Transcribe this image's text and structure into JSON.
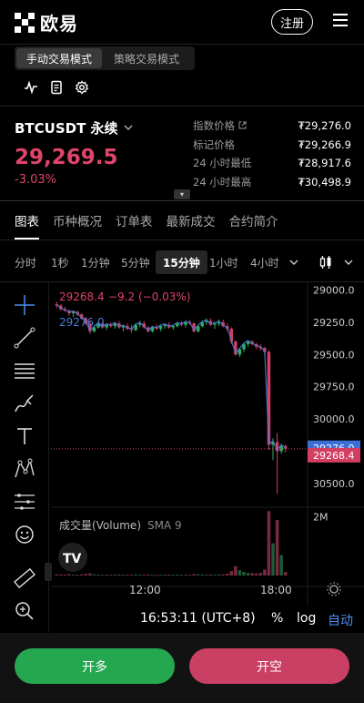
{
  "header": {
    "logo_text": "欧易",
    "register_label": "注册"
  },
  "modes": {
    "manual_label": "手动交易模式",
    "strategy_label": "策略交易模式"
  },
  "ticker": {
    "pair": "BTCUSDT 永续",
    "price": "29,269.5",
    "change": "-3.03%",
    "stats": [
      {
        "label": "指数价格",
        "value": "₮29,276.0"
      },
      {
        "label": "标记价格",
        "value": "₮29,266.9"
      },
      {
        "label": "24 小时最低",
        "value": "₮28,917.6"
      },
      {
        "label": "24 小时最高",
        "value": "₮30,498.9"
      }
    ]
  },
  "tabs": [
    "图表",
    "币种概况",
    "订单表",
    "最新成交",
    "合约简介"
  ],
  "intervals": [
    "分时",
    "1秒",
    "1分钟",
    "5分钟",
    "15分钟",
    "1小时",
    "4小时"
  ],
  "selected_interval": "15分钟",
  "chart": {
    "ohlc_label": "29268.4",
    "change_label": "−9.2 (−0.03%)",
    "index_label": "29276.0",
    "y_ticks": [
      "30500.0",
      "30250.0",
      "30000.0",
      "29750.0",
      "29500.0",
      "29250.0",
      "29000.0"
    ],
    "price_tag_index": "29276.0",
    "price_tag_last": "29268.4",
    "volume_label": "成交量(Volume)",
    "sma_label": "SMA 9",
    "volume_tick": "2M",
    "x_ticks": [
      "12:00",
      "18:00"
    ],
    "time_label": "16:53:11 (UTC+8)",
    "percent_label": "%",
    "log_label": "log",
    "auto_label": "自动",
    "colors": {
      "up": "#2bb064",
      "down": "#d23f62",
      "index_line": "#4a78d8"
    }
  },
  "chart_data": {
    "type": "candlestick",
    "x_ticks": [
      "12:00",
      "18:00"
    ],
    "ylim": [
      28900,
      30560
    ],
    "y_ticks": [
      29000,
      29250,
      29500,
      29750,
      30000,
      30250,
      30500
    ],
    "last_price": 29268.4,
    "index_price": 29276.0,
    "candles": [
      [
        30390,
        30410,
        30360,
        30380
      ],
      [
        30380,
        30390,
        30340,
        30350
      ],
      [
        30350,
        30370,
        30330,
        30340
      ],
      [
        30340,
        30350,
        30300,
        30320
      ],
      [
        30320,
        30340,
        30290,
        30330
      ],
      [
        30330,
        30340,
        30300,
        30310
      ],
      [
        30310,
        30320,
        30270,
        30280
      ],
      [
        30280,
        30290,
        30230,
        30240
      ],
      [
        30240,
        30260,
        30160,
        30180
      ],
      [
        30180,
        30220,
        30170,
        30210
      ],
      [
        30210,
        30250,
        30200,
        30240
      ],
      [
        30240,
        30250,
        30200,
        30210
      ],
      [
        30210,
        30240,
        30190,
        30230
      ],
      [
        30230,
        30250,
        30210,
        30220
      ],
      [
        30220,
        30250,
        30200,
        30240
      ],
      [
        30240,
        30260,
        30200,
        30210
      ],
      [
        30210,
        30230,
        30180,
        30220
      ],
      [
        30220,
        30240,
        30190,
        30200
      ],
      [
        30200,
        30230,
        30170,
        30190
      ],
      [
        30190,
        30240,
        30180,
        30230
      ],
      [
        30230,
        30260,
        30210,
        30240
      ],
      [
        30240,
        30260,
        30200,
        30210
      ],
      [
        30210,
        30220,
        30170,
        30180
      ],
      [
        30180,
        30220,
        30170,
        30210
      ],
      [
        30210,
        30230,
        30190,
        30200
      ],
      [
        30200,
        30230,
        30180,
        30220
      ],
      [
        30220,
        30240,
        30200,
        30230
      ],
      [
        30230,
        30250,
        30200,
        30210
      ],
      [
        30210,
        30230,
        30190,
        30220
      ],
      [
        30220,
        30250,
        30210,
        30240
      ],
      [
        30240,
        30260,
        30220,
        30230
      ],
      [
        30230,
        30260,
        30210,
        30250
      ],
      [
        30250,
        30270,
        30230,
        30240
      ],
      [
        30240,
        30250,
        30170,
        30180
      ],
      [
        30180,
        30230,
        30170,
        30220
      ],
      [
        30220,
        30260,
        30210,
        30250
      ],
      [
        30250,
        30280,
        30230,
        30260
      ],
      [
        30260,
        30280,
        30220,
        30230
      ],
      [
        30230,
        30250,
        30200,
        30240
      ],
      [
        30240,
        30270,
        30220,
        30250
      ],
      [
        30250,
        30270,
        30210,
        30220
      ],
      [
        30220,
        30240,
        30180,
        30200
      ],
      [
        30200,
        30210,
        30080,
        30100
      ],
      [
        30100,
        30110,
        29990,
        30000
      ],
      [
        30000,
        30050,
        29980,
        30040
      ],
      [
        30040,
        30090,
        30020,
        30080
      ],
      [
        30080,
        30110,
        30060,
        30100
      ],
      [
        30100,
        30110,
        30070,
        30080
      ],
      [
        30080,
        30090,
        30040,
        30060
      ],
      [
        30060,
        30080,
        30030,
        30050
      ],
      [
        30050,
        30060,
        29990,
        30020
      ],
      [
        30020,
        30030,
        29260,
        29300
      ],
      [
        29300,
        29350,
        29180,
        29320
      ],
      [
        29320,
        29390,
        28920,
        29250
      ],
      [
        29250,
        29310,
        29230,
        29290
      ],
      [
        29290,
        29300,
        29240,
        29270
      ]
    ],
    "volume_ylim": [
      0,
      2300000
    ],
    "volume": [
      40000,
      35000,
      30000,
      45000,
      30000,
      25000,
      40000,
      50000,
      70000,
      35000,
      30000,
      25000,
      30000,
      25000,
      30000,
      35000,
      25000,
      30000,
      25000,
      35000,
      30000,
      30000,
      35000,
      25000,
      20000,
      25000,
      25000,
      30000,
      25000,
      30000,
      25000,
      30000,
      25000,
      50000,
      40000,
      35000,
      30000,
      35000,
      30000,
      35000,
      40000,
      60000,
      150000,
      320000,
      180000,
      120000,
      90000,
      80000,
      70000,
      90000,
      200000,
      2200000,
      1100000,
      1900000,
      700000,
      120000
    ]
  }
}
